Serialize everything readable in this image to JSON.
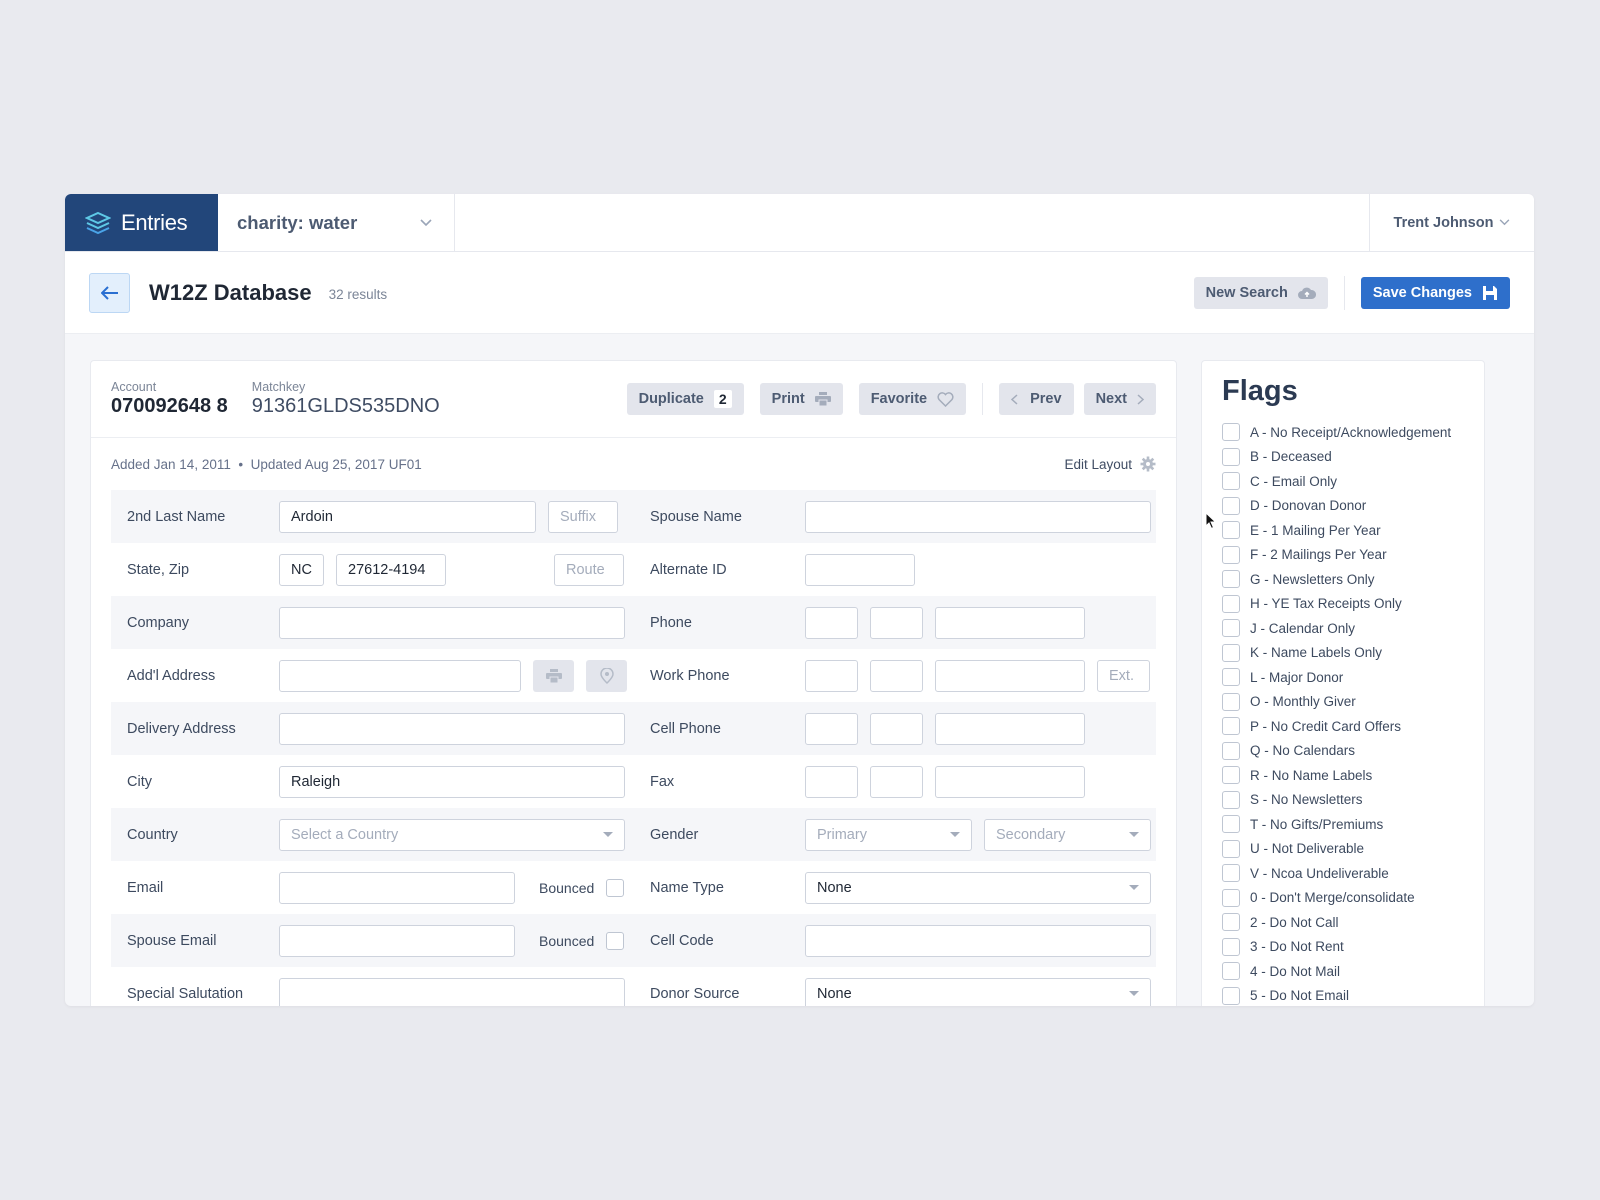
{
  "nav": {
    "brand": "Entries",
    "org": "charity: water",
    "user": "Trent Johnson"
  },
  "header": {
    "title": "W12Z Database",
    "results": "32 results",
    "new_search": "New Search",
    "save_changes": "Save Changes"
  },
  "record": {
    "account_label": "Account",
    "account": "070092648 8",
    "matchkey_label": "Matchkey",
    "matchkey": "91361GLDS535DNO",
    "duplicate": "Duplicate",
    "duplicate_count": "2",
    "print": "Print",
    "favorite": "Favorite",
    "prev": "Prev",
    "next": "Next",
    "meta": "Added Jan 14, 2011  •  Updated Aug 25, 2017 UF01",
    "edit_layout": "Edit Layout"
  },
  "form": {
    "second_last_name": {
      "label": "2nd Last Name",
      "value": "Ardoin",
      "suffix_placeholder": "Suffix"
    },
    "state_zip": {
      "label": "State, Zip",
      "state": "NC",
      "zip": "27612-4194",
      "route_placeholder": "Route"
    },
    "company": {
      "label": "Company",
      "value": ""
    },
    "addl_address": {
      "label": "Add'l Address",
      "value": ""
    },
    "delivery_address": {
      "label": "Delivery Address",
      "value": ""
    },
    "city": {
      "label": "City",
      "value": "Raleigh"
    },
    "country": {
      "label": "Country",
      "placeholder": "Select a Country"
    },
    "email": {
      "label": "Email",
      "value": "",
      "bounced_label": "Bounced"
    },
    "spouse_email": {
      "label": "Spouse Email",
      "value": "",
      "bounced_label": "Bounced"
    },
    "special_salutation": {
      "label": "Special Salutation",
      "value": ""
    },
    "spouse_name": {
      "label": "Spouse Name",
      "value": ""
    },
    "alternate_id": {
      "label": "Alternate ID",
      "value": ""
    },
    "phone": {
      "label": "Phone"
    },
    "work_phone": {
      "label": "Work Phone",
      "ext_placeholder": "Ext."
    },
    "cell_phone": {
      "label": "Cell Phone"
    },
    "fax": {
      "label": "Fax"
    },
    "gender": {
      "label": "Gender",
      "primary_placeholder": "Primary",
      "secondary_placeholder": "Secondary"
    },
    "name_type": {
      "label": "Name Type",
      "value": "None"
    },
    "cell_code": {
      "label": "Cell Code",
      "value": ""
    },
    "donor_source": {
      "label": "Donor Source",
      "value": "None"
    }
  },
  "flags": {
    "title": "Flags",
    "items": [
      "A - No Receipt/Acknowledgement",
      "B - Deceased",
      "C - Email Only",
      "D - Donovan Donor",
      "E - 1 Mailing Per Year",
      "F - 2 Mailings Per Year",
      "G - Newsletters Only",
      "H - YE Tax Receipts Only",
      "J - Calendar Only",
      "K - Name Labels Only",
      "L - Major Donor",
      "O - Monthly Giver",
      "P - No Credit Card Offers",
      "Q - No Calendars",
      "R - No Name Labels",
      "S - No Newsletters",
      "T - No Gifts/Premiums",
      "U - Not Deliverable",
      "V - Ncoa Undeliverable",
      "0 - Don't Merge/consolidate",
      "2 - Do Not Call",
      "3 - Do Not Rent",
      "4 - Do Not Mail",
      "5 - Do Not Email"
    ]
  }
}
